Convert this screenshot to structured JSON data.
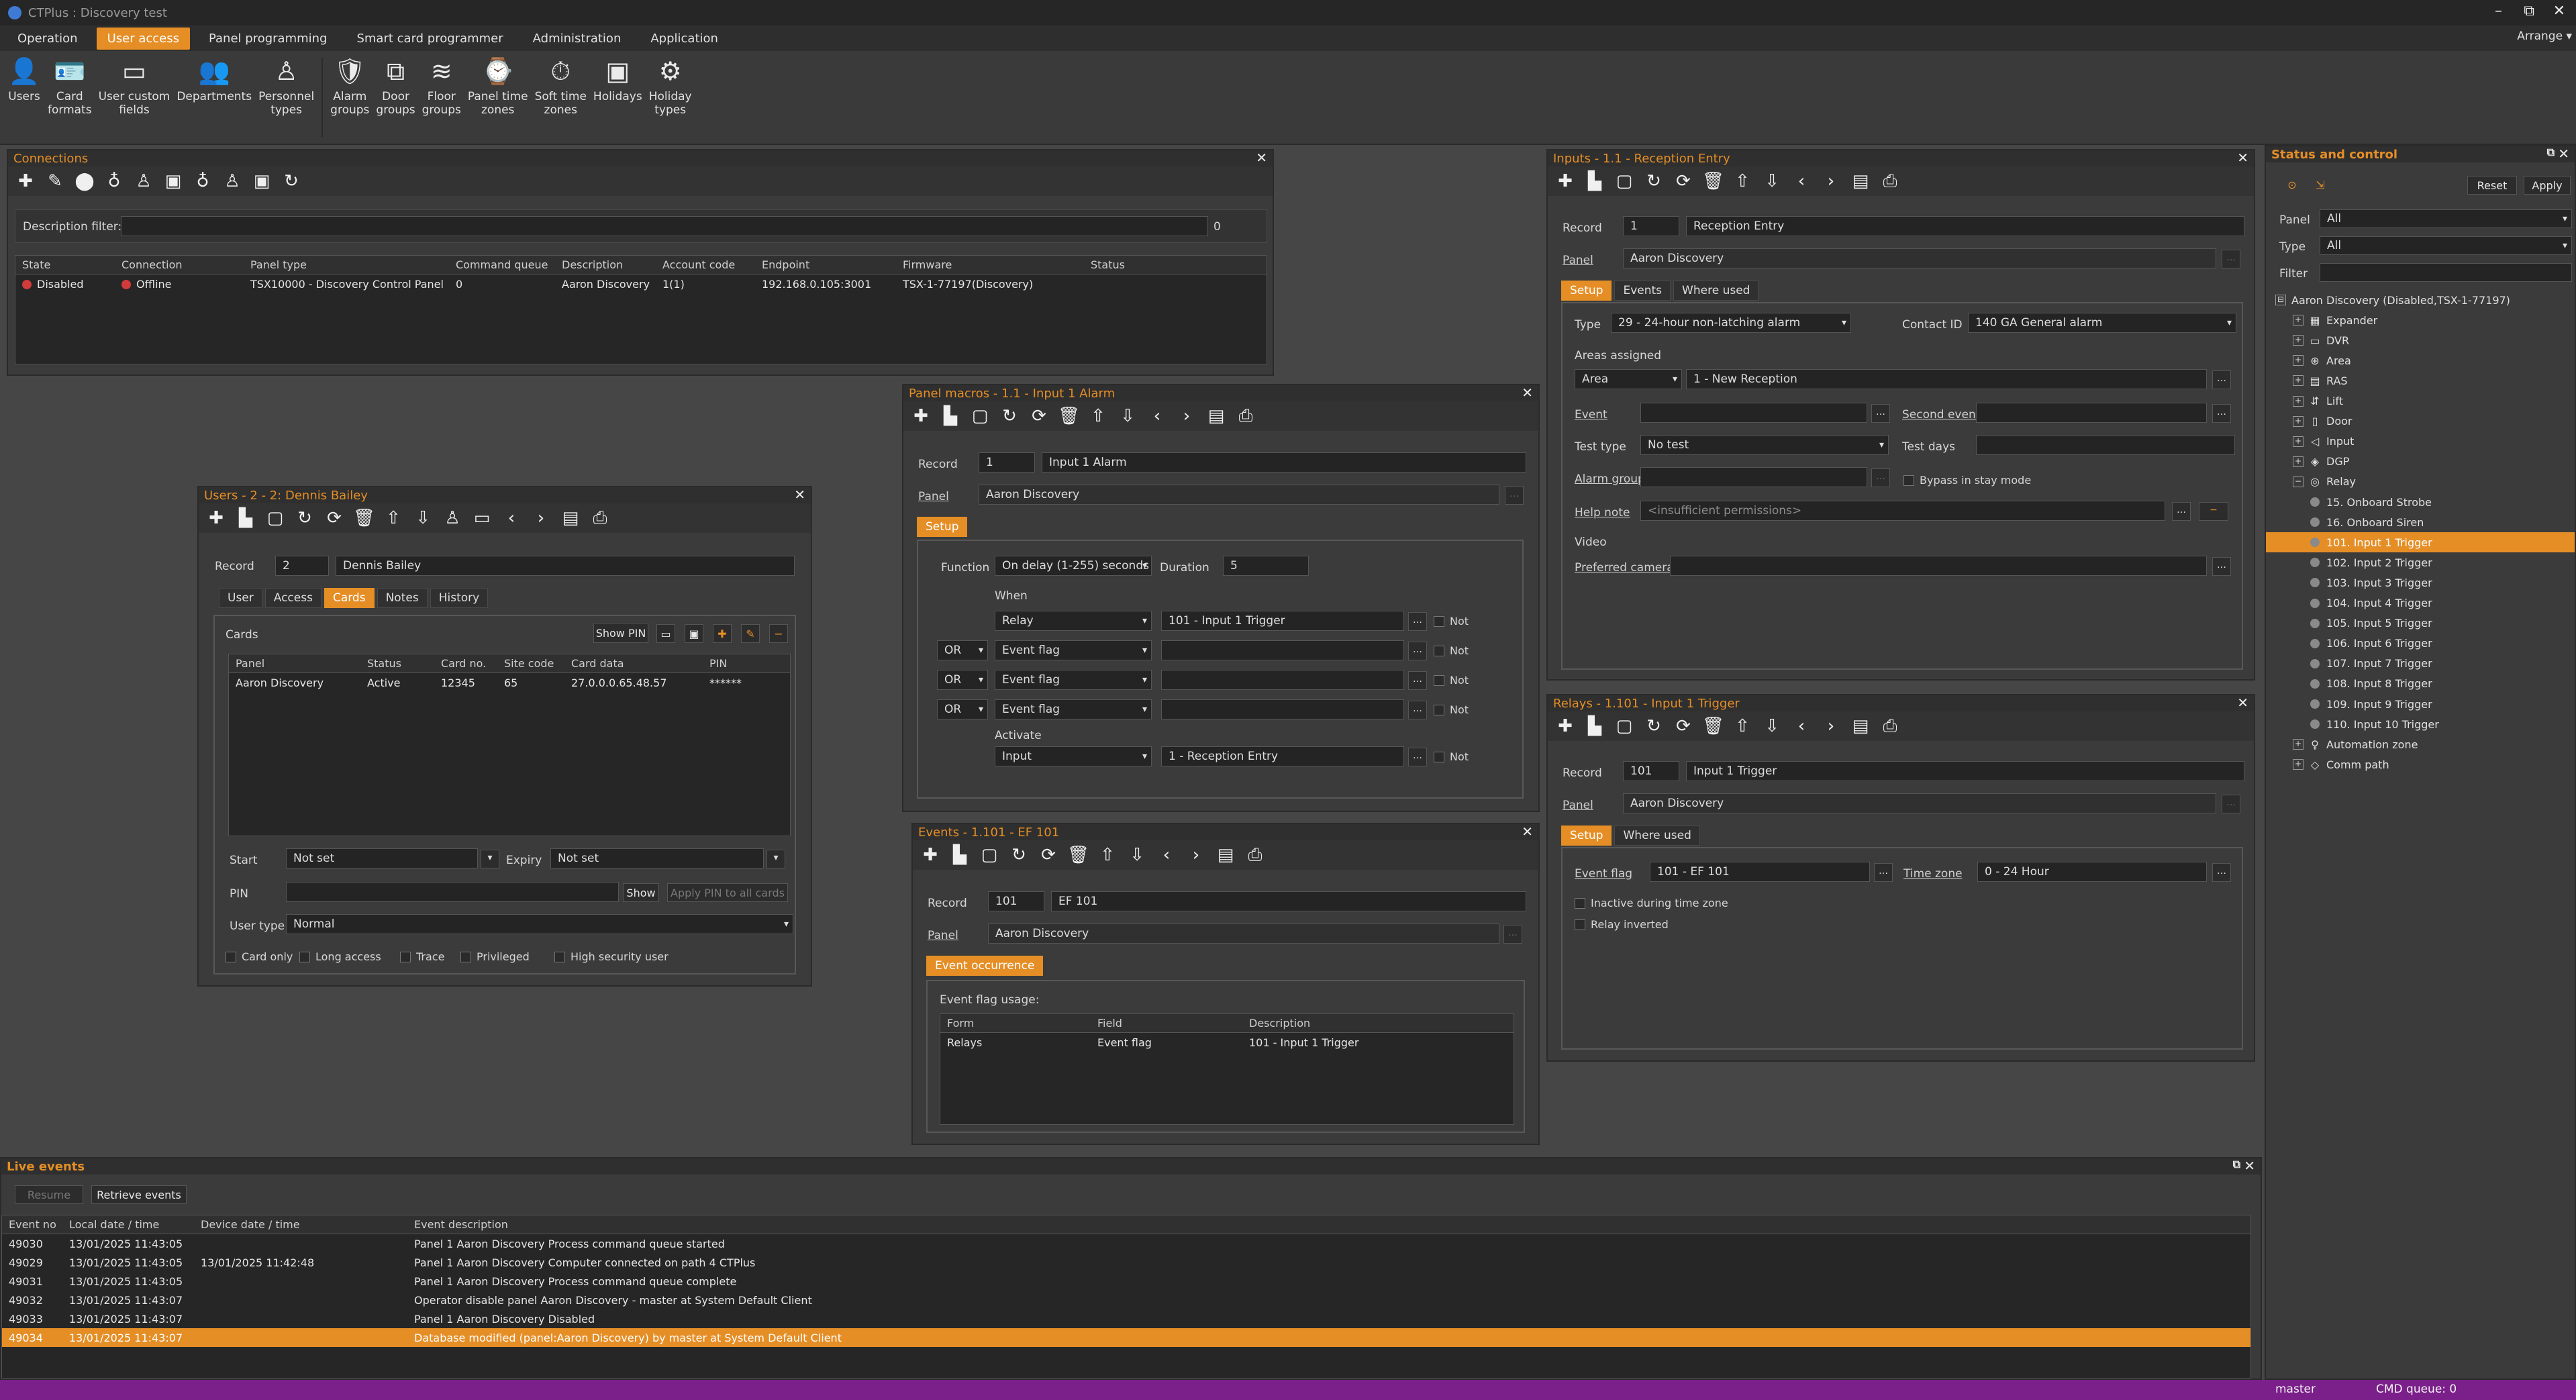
{
  "app": {
    "title": "CTPlus : Discovery test",
    "arrange_label": "Arrange",
    "window_controls": [
      "minimize-icon",
      "restore-icon",
      "close-icon"
    ]
  },
  "menu": [
    "Operation",
    "User access",
    "Panel programming",
    "Smart card programmer",
    "Administration",
    "Application"
  ],
  "menu_active": "User access",
  "ribbon": [
    {
      "label": "Users",
      "icon": "users-icon",
      "glyph": "👤"
    },
    {
      "label": "Card\nformats",
      "icon": "card-formats-icon",
      "glyph": "🪪"
    },
    {
      "label": "User custom\nfields",
      "icon": "custom-fields-icon",
      "glyph": "▭"
    },
    {
      "label": "Departments",
      "icon": "departments-icon",
      "glyph": "👥"
    },
    {
      "label": "Personnel\ntypes",
      "icon": "personnel-icon",
      "glyph": "♙"
    },
    {
      "label": "Alarm\ngroups",
      "icon": "alarm-groups-icon",
      "glyph": "🛡"
    },
    {
      "label": "Door\ngroups",
      "icon": "door-groups-icon",
      "glyph": "⧉"
    },
    {
      "label": "Floor\ngroups",
      "icon": "floor-groups-icon",
      "glyph": "≋"
    },
    {
      "label": "Panel time\nzones",
      "icon": "panel-time-zones-icon",
      "glyph": "⌚"
    },
    {
      "label": "Soft time\nzones",
      "icon": "soft-time-zones-icon",
      "glyph": "⏱"
    },
    {
      "label": "Holidays",
      "icon": "holidays-icon",
      "glyph": "▣"
    },
    {
      "label": "Holiday\ntypes",
      "icon": "holiday-types-icon",
      "glyph": "⚙"
    }
  ],
  "connections": {
    "title": "Connections",
    "filter_label": "Description filter:",
    "filter_count": "0",
    "columns": [
      "State",
      "Connection",
      "Panel type",
      "Command queue",
      "Description",
      "Account code",
      "Endpoint",
      "Firmware",
      "Status"
    ],
    "rows": [
      {
        "state": "Disabled",
        "connection": "Offline",
        "panel_type": "TSX10000 - Discovery Control Panel",
        "queue": "0",
        "description": "Aaron Discovery",
        "account": "1(1)",
        "endpoint": "192.168.0.105:3001",
        "firmware": "TSX-1-77197(Discovery)",
        "status": ""
      }
    ]
  },
  "users": {
    "title": "Users - 2 - 2: Dennis Bailey",
    "record_label": "Record",
    "record_no": "2",
    "record_name": "Dennis Bailey",
    "tabs": [
      "User",
      "Access",
      "Cards",
      "Notes",
      "History"
    ],
    "active_tab": "Cards",
    "cards_label": "Cards",
    "show_pin": "Show PIN",
    "columns": [
      "Panel",
      "Status",
      "Card no.",
      "Site code",
      "Card data",
      "PIN"
    ],
    "rows": [
      {
        "panel": "Aaron Discovery",
        "status": "Active",
        "card_no": "12345",
        "site": "65",
        "card_data": "27.0.0.0.65.48.57",
        "pin": "******"
      }
    ],
    "start_label": "Start",
    "start_value": "Not set",
    "expiry_label": "Expiry",
    "expiry_value": "Not set",
    "pin_label": "PIN",
    "show": "Show",
    "apply_pin": "Apply PIN to all cards",
    "user_type_label": "User type",
    "user_type_value": "Normal",
    "checks": [
      "Card only",
      "Long access",
      "Trace",
      "Privileged",
      "High security user"
    ]
  },
  "macros": {
    "title": "Panel macros - 1.1 - Input 1 Alarm",
    "record_label": "Record",
    "record_no": "1",
    "record_name": "Input 1 Alarm",
    "panel_label": "Panel",
    "panel_value": "Aaron Discovery",
    "tab": "Setup",
    "function_label": "Function",
    "function_value": "On delay (1-255) seconds",
    "duration_label": "Duration",
    "duration_value": "5",
    "when_label": "When",
    "activate_label": "Activate",
    "not_label": "Not",
    "when_rows": [
      {
        "op": "",
        "type": "Relay",
        "value": "101 - Input 1 Trigger"
      },
      {
        "op": "OR",
        "type": "Event flag",
        "value": ""
      },
      {
        "op": "OR",
        "type": "Event flag",
        "value": ""
      },
      {
        "op": "OR",
        "type": "Event flag",
        "value": ""
      }
    ],
    "activate_type": "Input",
    "activate_value": "1 - Reception Entry"
  },
  "events_panel": {
    "title": "Events - 1.101 - EF 101",
    "record_label": "Record",
    "record_no": "101",
    "record_name": "EF 101",
    "panel_label": "Panel",
    "panel_value": "Aaron Discovery",
    "tab": "Event occurrence",
    "usage_label": "Event flag usage:",
    "columns": [
      "Form",
      "Field",
      "Description"
    ],
    "rows": [
      {
        "form": "Relays",
        "field": "Event flag",
        "description": "101 - Input 1 Trigger"
      }
    ]
  },
  "inputs": {
    "title": "Inputs - 1.1 - Reception Entry",
    "record_label": "Record",
    "record_no": "1",
    "record_name": "Reception Entry",
    "panel_label": "Panel",
    "panel_value": "Aaron Discovery",
    "tabs": [
      "Setup",
      "Events",
      "Where used"
    ],
    "type_label": "Type",
    "type_value": "29 - 24-hour non-latching alarm",
    "contact_label": "Contact ID",
    "contact_value": "140 GA General alarm",
    "areas_label": "Areas assigned",
    "area_type": "Area",
    "area_value": "1 - New Reception",
    "event_label": "Event",
    "second_event_label": "Second event",
    "test_type_label": "Test type",
    "test_type_value": "No test",
    "test_days_label": "Test days",
    "alarm_group_label": "Alarm group",
    "bypass_label": "Bypass in stay mode",
    "help_label": "Help note",
    "help_value": "<insufficient permissions>",
    "video_label": "Video",
    "camera_label": "Preferred camera"
  },
  "relays": {
    "title": "Relays - 1.101 - Input 1 Trigger",
    "record_label": "Record",
    "record_no": "101",
    "record_name": "Input 1 Trigger",
    "panel_label": "Panel",
    "panel_value": "Aaron Discovery",
    "tabs": [
      "Setup",
      "Where used"
    ],
    "event_flag_label": "Event flag",
    "event_flag_value": "101 - EF 101",
    "time_zone_label": "Time zone",
    "time_zone_value": "0 - 24 Hour",
    "checks": [
      "Inactive during time zone",
      "Relay inverted"
    ]
  },
  "status": {
    "title": "Status and control",
    "reset": "Reset",
    "apply": "Apply",
    "panel_label": "Panel",
    "panel_value": "All",
    "type_label": "Type",
    "type_value": "All",
    "filter_label": "Filter",
    "tree": [
      {
        "level": 0,
        "exp": "⊟",
        "icon": "",
        "label": "Aaron Discovery (Disabled,TSX-1-77197)"
      },
      {
        "level": 1,
        "exp": "+",
        "icon": "▦",
        "label": "Expander"
      },
      {
        "level": 1,
        "exp": "+",
        "icon": "▭",
        "label": "DVR"
      },
      {
        "level": 1,
        "exp": "+",
        "icon": "⊕",
        "label": "Area"
      },
      {
        "level": 1,
        "exp": "+",
        "icon": "▤",
        "label": "RAS"
      },
      {
        "level": 1,
        "exp": "+",
        "icon": "⇵",
        "label": "Lift"
      },
      {
        "level": 1,
        "exp": "+",
        "icon": "▯",
        "label": "Door"
      },
      {
        "level": 1,
        "exp": "+",
        "icon": "◁",
        "label": "Input"
      },
      {
        "level": 1,
        "exp": "+",
        "icon": "◈",
        "label": "DGP"
      },
      {
        "level": 1,
        "exp": "−",
        "icon": "◎",
        "label": "Relay"
      },
      {
        "level": 2,
        "exp": "",
        "icon": "dot",
        "label": "15. Onboard Strobe"
      },
      {
        "level": 2,
        "exp": "",
        "icon": "dot",
        "label": "16. Onboard Siren"
      },
      {
        "level": 2,
        "exp": "",
        "icon": "dot",
        "label": "101. Input 1 Trigger",
        "selected": true
      },
      {
        "level": 2,
        "exp": "",
        "icon": "dot",
        "label": "102. Input 2 Trigger"
      },
      {
        "level": 2,
        "exp": "",
        "icon": "dot",
        "label": "103. Input 3 Trigger"
      },
      {
        "level": 2,
        "exp": "",
        "icon": "dot",
        "label": "104. Input 4 Trigger"
      },
      {
        "level": 2,
        "exp": "",
        "icon": "dot",
        "label": "105. Input 5 Trigger"
      },
      {
        "level": 2,
        "exp": "",
        "icon": "dot",
        "label": "106. Input 6 Trigger"
      },
      {
        "level": 2,
        "exp": "",
        "icon": "dot",
        "label": "107. Input 7 Trigger"
      },
      {
        "level": 2,
        "exp": "",
        "icon": "dot",
        "label": "108. Input 8 Trigger"
      },
      {
        "level": 2,
        "exp": "",
        "icon": "dot",
        "label": "109. Input 9 Trigger"
      },
      {
        "level": 2,
        "exp": "",
        "icon": "dot",
        "label": "110. Input 10 Trigger"
      },
      {
        "level": 1,
        "exp": "+",
        "icon": "♀",
        "label": "Automation zone"
      },
      {
        "level": 1,
        "exp": "+",
        "icon": "◇",
        "label": "Comm path"
      }
    ]
  },
  "live_events": {
    "title": "Live events",
    "resume": "Resume",
    "retrieve": "Retrieve events",
    "columns": [
      "Event no",
      "Local date / time",
      "Device date / time",
      "Event description"
    ],
    "rows": [
      {
        "no": "49030",
        "local": "13/01/2025 11:43:05",
        "device": "",
        "desc": "Panel 1 Aaron Discovery Process command queue started"
      },
      {
        "no": "49029",
        "local": "13/01/2025 11:43:05",
        "device": "13/01/2025 11:42:48",
        "desc": "Panel 1 Aaron Discovery Computer connected on path 4 CTPlus"
      },
      {
        "no": "49031",
        "local": "13/01/2025 11:43:05",
        "device": "",
        "desc": "Panel 1 Aaron Discovery Process command queue complete"
      },
      {
        "no": "49032",
        "local": "13/01/2025 11:43:07",
        "device": "",
        "desc": "Operator disable panel Aaron Discovery - master at System Default Client"
      },
      {
        "no": "49033",
        "local": "13/01/2025 11:43:07",
        "device": "",
        "desc": "Panel 1 Aaron Discovery Disabled"
      },
      {
        "no": "49034",
        "local": "13/01/2025 11:43:07",
        "device": "",
        "desc": "Database modified (panel:Aaron Discovery) by master at System Default Client",
        "selected": true
      }
    ]
  },
  "statusbar": {
    "user": "master",
    "cmd_queue": "CMD queue: 0"
  },
  "colors": {
    "accent": "#e58e26",
    "statusbar": "#7b1f8a",
    "panel": "#3b3b3b",
    "offline": "#d23b3b"
  }
}
